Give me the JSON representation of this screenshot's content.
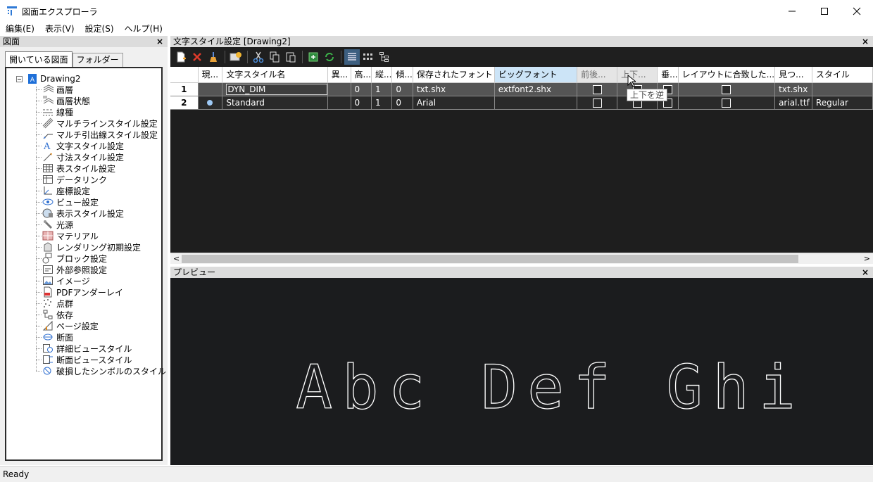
{
  "window": {
    "title": "図面エクスプローラ",
    "minimize_glyph": "—",
    "maximize_glyph": "☐",
    "close_glyph": "✕"
  },
  "menu": {
    "items": [
      "編集(E)",
      "表示(V)",
      "設定(S)",
      "ヘルプ(H)"
    ]
  },
  "left_panel": {
    "title": "図面",
    "close": "×",
    "tabs": [
      "開いている図面",
      "フォルダー"
    ],
    "tree_root": "Drawing2",
    "tree_items": [
      {
        "label": "画層",
        "icon": "layer-icon"
      },
      {
        "label": "画層状態",
        "icon": "layer-state-icon"
      },
      {
        "label": "線種",
        "icon": "linetype-icon"
      },
      {
        "label": "マルチラインスタイル設定",
        "icon": "multiline-icon"
      },
      {
        "label": "マルチ引出線スタイル設定",
        "icon": "multileader-icon"
      },
      {
        "label": "文字スタイル設定",
        "icon": "text-style-icon"
      },
      {
        "label": "寸法スタイル設定",
        "icon": "dimension-style-icon"
      },
      {
        "label": "表スタイル設定",
        "icon": "table-style-icon"
      },
      {
        "label": "データリンク",
        "icon": "data-link-icon"
      },
      {
        "label": "座標設定",
        "icon": "ucs-icon"
      },
      {
        "label": "ビュー設定",
        "icon": "view-icon"
      },
      {
        "label": "表示スタイル設定",
        "icon": "visual-style-icon"
      },
      {
        "label": "光源",
        "icon": "light-icon"
      },
      {
        "label": "マテリアル",
        "icon": "material-icon"
      },
      {
        "label": "レンダリング初期設定",
        "icon": "render-preset-icon"
      },
      {
        "label": "ブロック設定",
        "icon": "block-icon"
      },
      {
        "label": "外部参照設定",
        "icon": "xref-icon"
      },
      {
        "label": "イメージ",
        "icon": "image-icon"
      },
      {
        "label": "PDFアンダーレイ",
        "icon": "pdf-underlay-icon"
      },
      {
        "label": "点群",
        "icon": "point-cloud-icon"
      },
      {
        "label": "依存",
        "icon": "dependency-icon"
      },
      {
        "label": "ページ設定",
        "icon": "page-setup-icon"
      },
      {
        "label": "断面",
        "icon": "section-icon"
      },
      {
        "label": "詳細ビュースタイル",
        "icon": "detail-view-style-icon"
      },
      {
        "label": "断面ビュースタイル",
        "icon": "section-view-style-icon"
      },
      {
        "label": "破損したシンボルのスタイル",
        "icon": "broken-symbol-style-icon"
      }
    ]
  },
  "text_style_panel": {
    "title": "文字スタイル設定 [Drawing2]",
    "close": "×",
    "columns": [
      "現...",
      "文字スタイル名",
      "異...",
      "高...",
      "縦...",
      "傾...",
      "保存されたフォント",
      "ビッグフォント",
      "前後...",
      "上下...",
      "垂...",
      "レイアウトに合致した...",
      "見つ...",
      "スタイル"
    ],
    "rows": [
      {
        "num": "1",
        "current": "",
        "name": "DYN_DIM",
        "annotative": "",
        "height": "0",
        "width": "1",
        "oblique": "0",
        "saved_font": "txt.shx",
        "big_font": "extfont2.shx",
        "backwards": false,
        "upside_down": false,
        "vertical": false,
        "layout_match": false,
        "found": "txt.shx",
        "style": ""
      },
      {
        "num": "2",
        "current": "●",
        "name": "Standard",
        "annotative": "",
        "height": "0",
        "width": "1",
        "oblique": "0",
        "saved_font": "Arial",
        "big_font": "",
        "backwards": false,
        "upside_down": false,
        "vertical": false,
        "layout_match": false,
        "found": "arial.ttf",
        "style": "Regular"
      }
    ],
    "tooltip": "上下を逆",
    "scroll_left": "<",
    "scroll_right": ">"
  },
  "preview_panel": {
    "title": "プレビュー",
    "close": "×",
    "sample_text": "Abc Def Ghi",
    "colors": {
      "background": "#1b1c1e",
      "stroke": "#ffffff"
    }
  },
  "status": {
    "text": "Ready"
  }
}
